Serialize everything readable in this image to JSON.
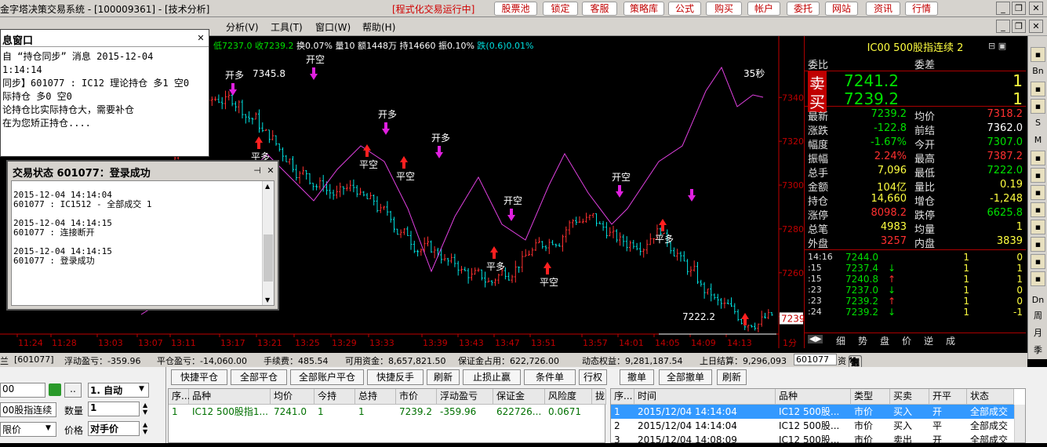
{
  "window": {
    "title": "金字塔决策交易系统 - [100009361] - [技术分析]",
    "banner": "[程式化交易运行中]",
    "top_buttons": [
      "股票池",
      "锁定",
      "客服",
      "策略库",
      "公式",
      "购买",
      "帐户",
      "委托",
      "网站",
      "资讯",
      "行情"
    ]
  },
  "menu": [
    "分析(V)",
    "工具(T)",
    "窗口(W)",
    "帮助(H)"
  ],
  "quote_bar": {
    "low": "低7237.0",
    "close": "收7239.2",
    "turnover": "换0.07%",
    "volume": "量10",
    "amount": "额1448万",
    "position": "持14660",
    "amplitude": "振0.10%",
    "fall": "跌(0.6)0.01%"
  },
  "chart_data": {
    "type": "candlestick",
    "y_ticks": [
      "7340",
      "7320",
      "7300",
      "7280",
      "7260",
      "7240"
    ],
    "y_range": [
      7232,
      7358
    ],
    "x_ticks": [
      "11:24",
      "11:28",
      "13:03",
      "13:07",
      "13:11",
      "13:17",
      "13:21",
      "13:25",
      "13:29",
      "13:33",
      "13:39",
      "13:43",
      "13:47",
      "13:51",
      "13:57",
      "14:01",
      "14:05",
      "14:09",
      "14:13"
    ],
    "annotations": {
      "high": "7345.8",
      "low": "7222.2",
      "timer": "35秒",
      "last_price_tag": "7239"
    },
    "signals": [
      "开多",
      "平多",
      "开空",
      "平空",
      "开多",
      "平空",
      "开多",
      "平多",
      "开空",
      "平空",
      "开空",
      "平多"
    ],
    "period_label": "1分"
  },
  "msg_window": {
    "title": "息窗口",
    "lines": [
      "自 “持仓同步” 消息 2015-12-04",
      "1:14:14",
      "同步】601077 : IC12 理论持仓 多1 空0",
      "际持仓 多0 空0",
      "论持仓比实际持仓大，需要补仓",
      "在为您矫正持仓...."
    ]
  },
  "trade_status": {
    "title": "交易状态 601077：登录成功",
    "lines": [
      "2015-12-04 14:14:04",
      "601077 : IC1512 - 全部成交 1",
      "",
      "2015-12-04 14:14:15",
      "601077 : 连接断开",
      "",
      "2015-12-04 14:14:15",
      "601077 : 登录成功"
    ]
  },
  "panel": {
    "title": "IC00 500股指连续 2",
    "wb_label": "委比",
    "wc_label": "委差",
    "sell_label": "卖",
    "sell_price": "7241.2",
    "sell_vol": "1",
    "buy_label": "买",
    "buy_price": "7239.2",
    "buy_vol": "1",
    "rows": [
      {
        "l1": "最新",
        "v1": "7239.2",
        "l2": "均价",
        "v2": "7318.2"
      },
      {
        "l1": "涨跌",
        "v1": "-122.8",
        "l2": "前结",
        "v2": "7362.0"
      },
      {
        "l1": "幅度",
        "v1": "-1.67%",
        "l2": "今开",
        "v2": "7307.0"
      },
      {
        "l1": "振幅",
        "v1": "2.24%",
        "l2": "最高",
        "v2": "7387.2"
      },
      {
        "l1": "总手",
        "v1": "7,096",
        "l2": "最低",
        "v2": "7222.0"
      },
      {
        "l1": "金额",
        "v1": "104亿",
        "l2": "量比",
        "v2": "0.19"
      },
      {
        "l1": "持仓",
        "v1": "14,660",
        "l2": "增仓",
        "v2": "-1,248"
      },
      {
        "l1": "涨停",
        "v1": "8098.2",
        "l2": "跌停",
        "v2": "6625.8"
      },
      {
        "l1": "总笔",
        "v1": "4983",
        "l2": "均量",
        "v2": "1"
      },
      {
        "l1": "外盘",
        "v1": "3257",
        "l2": "内盘",
        "v2": "3839"
      }
    ],
    "ticks": [
      {
        "t": "14:16",
        "p": "7244.0",
        "a": "",
        "v": "1",
        "c": "0"
      },
      {
        "t": ":15",
        "p": "7237.4",
        "a": "↓",
        "v": "1",
        "c": "1"
      },
      {
        "t": ":15",
        "p": "7240.8",
        "a": "↑",
        "v": "1",
        "c": "1"
      },
      {
        "t": ":23",
        "p": "7237.0",
        "a": "↓",
        "v": "1",
        "c": "0"
      },
      {
        "t": ":23",
        "p": "7239.2",
        "a": "↑",
        "v": "1",
        "c": "0"
      },
      {
        "t": ":24",
        "p": "7239.2",
        "a": "↓",
        "v": "1",
        "c": "-1"
      }
    ],
    "tabs": [
      "细",
      "势",
      "盘",
      "价",
      "逆",
      "成"
    ]
  },
  "right_tools": [
    "Bn",
    "S",
    "M",
    "周",
    "月",
    "季",
    "Dn"
  ],
  "statusbar": {
    "account": "[601077]",
    "float_pl": "浮动盈亏：-359.96",
    "close_pl": "平仓盈亏：-14,060.00",
    "fee": "手续费：485.54",
    "available": "可用资金：8,657,821.50",
    "margin": "保证金占用：622,726.00",
    "equity": "动态权益：9,281,187.54",
    "settle": "上日结算：9,296,093",
    "acct_select": "601077"
  },
  "order_form": {
    "code": "00",
    "auto_mode": "1. 自动",
    "product": "00股指连续",
    "qty_label": "数量",
    "qty": "1",
    "price_type": "限价",
    "price_label": "价格",
    "price_val": "对手价"
  },
  "pos_toolbar": [
    "快捷平仓",
    "全部平仓",
    "全部账户平仓",
    "快捷反手",
    "刷新",
    "止损止赢",
    "条件单",
    "行权"
  ],
  "pos_headers": [
    "序...",
    "品种",
    "均价",
    "今持",
    "总持",
    "市价",
    "浮动盈亏",
    "保证金",
    "风险度",
    "拢"
  ],
  "pos_row": [
    "1",
    "IC12 500股指1...",
    "7241.0",
    "1",
    "1",
    "7239.2",
    "-359.96",
    "622726...",
    "0.0671",
    ""
  ],
  "ord_toolbar": [
    "撤单",
    "全部撤单",
    "刷新"
  ],
  "ord_headers": [
    "序...",
    "时间",
    "品种",
    "类型",
    "买卖",
    "开平",
    "状态"
  ],
  "ord_rows": [
    [
      "1",
      "2015/12/04 14:14:04",
      "IC12 500股...",
      "市价",
      "买入",
      "开",
      "全部成交"
    ],
    [
      "2",
      "2015/12/04 14:14:04",
      "IC12 500股...",
      "市价",
      "买入",
      "平",
      "全部成交"
    ],
    [
      "3",
      "2015/12/04 14:08:09",
      "IC12 500股...",
      "市价",
      "卖出",
      "开",
      "全部成交"
    ]
  ],
  "colors": {
    "up": "#ff3030",
    "down": "#00e0e0",
    "ma": "#e040e0",
    "signal_up": "#ff2020",
    "signal_down": "#e020e0"
  }
}
